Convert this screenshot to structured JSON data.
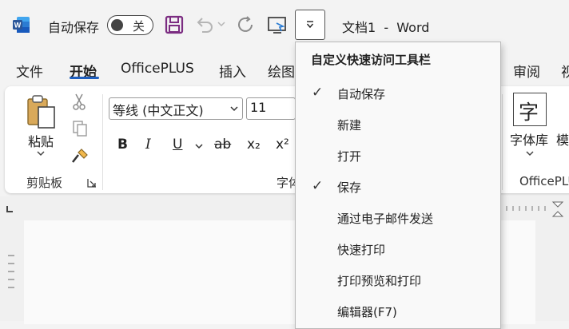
{
  "titlebar": {
    "app_icon": "word-icon",
    "app_icon_letter": "W",
    "autosave_label": "自动保存",
    "autosave_state": "关",
    "doc_title": "文档1  -  Word"
  },
  "tabs": [
    {
      "label": "文件"
    },
    {
      "label": "开始",
      "active": true
    },
    {
      "label": "OfficePLUS"
    },
    {
      "label": "插入"
    },
    {
      "label": "绘图"
    },
    {
      "label": "审阅"
    },
    {
      "label": "视"
    }
  ],
  "ribbon": {
    "paste_label": "粘贴",
    "clipboard_group": "剪贴板",
    "font_name": "等线 (中文正文)",
    "font_size": "11",
    "font_group_partial": "字体",
    "format_buttons": [
      "B",
      "I",
      "U",
      "ab",
      "x₂",
      "x²"
    ],
    "fontlib_glyph": "字",
    "fontlib_label": "字体库",
    "officeplus_group": "OfficePLUS",
    "partial_label": "模"
  },
  "menu": {
    "title": "自定义快速访问工具栏",
    "items": [
      {
        "label": "自动保存",
        "checked": true
      },
      {
        "label": "新建",
        "checked": false
      },
      {
        "label": "打开",
        "checked": false
      },
      {
        "label": "保存",
        "checked": true
      },
      {
        "label": "通过电子邮件发送",
        "checked": false
      },
      {
        "label": "快速打印",
        "checked": false
      },
      {
        "label": "打印预览和打印",
        "checked": false
      },
      {
        "label": "编辑器(F7)",
        "checked": false
      }
    ],
    "check_glyph": "✓"
  },
  "colors": {
    "word_blue": "#2b579a",
    "save_purple": "#7c2d82",
    "accent_underline": "#1f5fbf",
    "ribbon_bg": "#ffffff",
    "titlebar_bg": "#f3f3f3"
  }
}
